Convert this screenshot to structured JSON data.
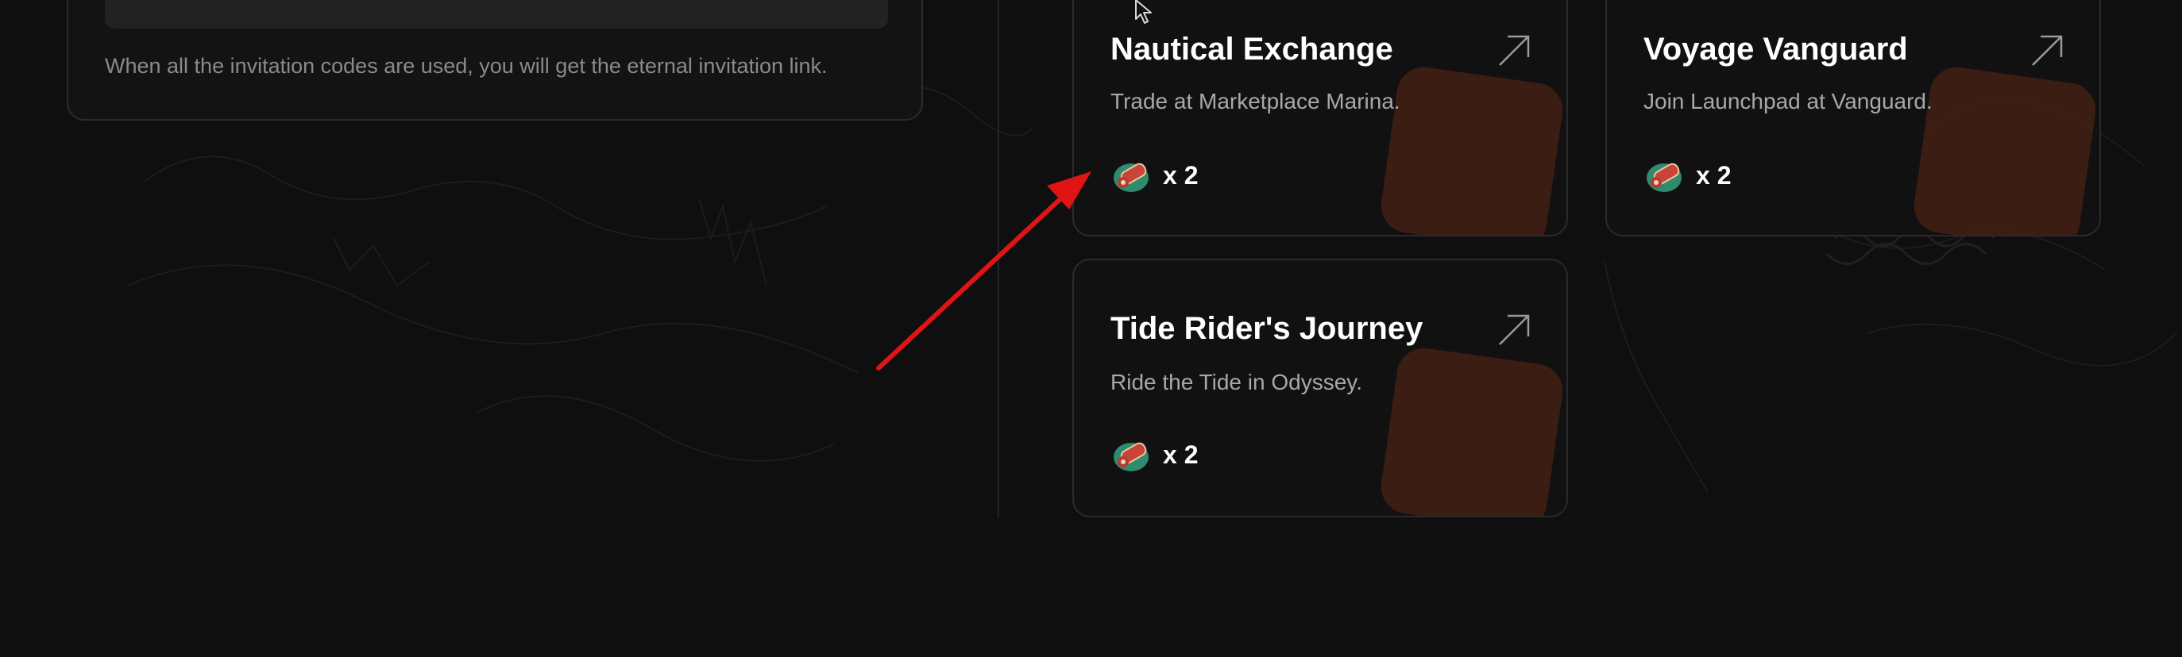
{
  "invite": {
    "note": "When all the invitation codes are used, you will get the eternal invitation link."
  },
  "cards": [
    {
      "title": "Nautical Exchange",
      "description": "Trade at Marketplace Marina.",
      "reward_count": "x 2",
      "reward_icon": "scroll-icon",
      "link_icon": "arrow-up-right-icon"
    },
    {
      "title": "Voyage Vanguard",
      "description": "Join Launchpad at Vanguard.",
      "reward_count": "x 2",
      "reward_icon": "scroll-icon",
      "link_icon": "arrow-up-right-icon"
    },
    {
      "title": "Tide Rider's Journey",
      "description": "Ride the Tide in Odyssey.",
      "reward_count": "x 2",
      "reward_icon": "scroll-icon",
      "link_icon": "arrow-up-right-icon"
    }
  ],
  "colors": {
    "background": "#0f0f0f",
    "card_border": "#2a2a2a",
    "annotation": "#e01414",
    "card_accent": "#aa3c1e"
  }
}
